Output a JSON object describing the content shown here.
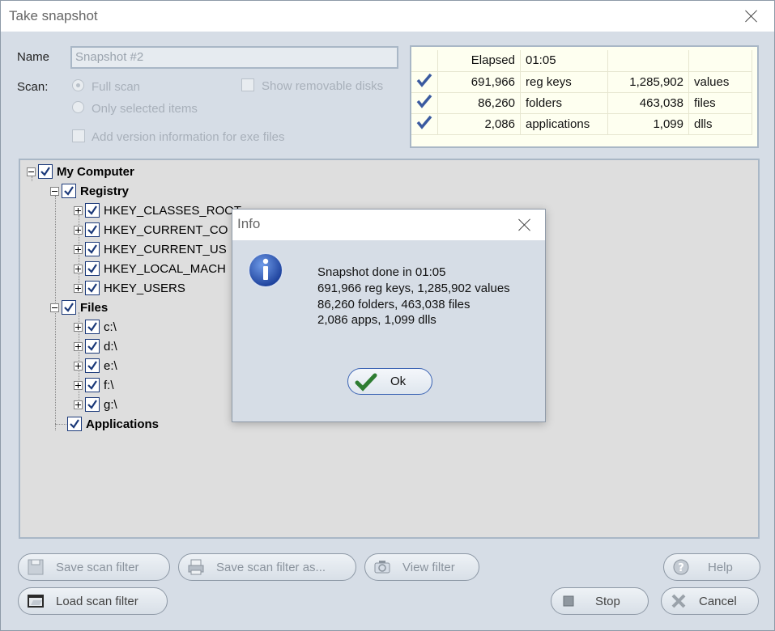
{
  "window": {
    "title": "Take snapshot"
  },
  "form": {
    "name_label": "Name",
    "name_value": "Snapshot #2",
    "scan_label": "Scan:",
    "full_scan": "Full scan",
    "only_selected": "Only selected items",
    "show_removable": "Show removable disks",
    "add_version": "Add version information for exe files"
  },
  "stats": {
    "elapsed_label": "Elapsed",
    "elapsed_value": "01:05",
    "rows": [
      {
        "count": "691,966",
        "label": "reg keys",
        "count2": "1,285,902",
        "label2": "values"
      },
      {
        "count": "86,260",
        "label": "folders",
        "count2": "463,038",
        "label2": "files"
      },
      {
        "count": "2,086",
        "label": "applications",
        "count2": "1,099",
        "label2": "dlls"
      }
    ]
  },
  "tree": {
    "root": "My Computer",
    "registry": "Registry",
    "registry_items": [
      "HKEY_CLASSES_ROOT",
      "HKEY_CURRENT_CO",
      "HKEY_CURRENT_US",
      "HKEY_LOCAL_MACH",
      "HKEY_USERS"
    ],
    "files": "Files",
    "file_items": [
      "c:\\",
      "d:\\",
      "e:\\",
      "f:\\",
      "g:\\"
    ],
    "applications": "Applications"
  },
  "buttons": {
    "save_filter": "Save scan filter",
    "save_filter_as": "Save scan filter as...",
    "view_filter": "View filter",
    "help": "Help",
    "load_filter": "Load scan filter",
    "stop": "Stop",
    "cancel": "Cancel"
  },
  "dialog": {
    "title": "Info",
    "lines": [
      "Snapshot done in 01:05",
      "691,966 reg keys, 1,285,902 values",
      "86,260 folders, 463,038 files",
      "2,086 apps, 1,099 dlls"
    ],
    "ok": "Ok"
  },
  "colors": {
    "window_bg": "#d6dde6",
    "stats_bg": "#fefff0",
    "tree_bg": "#dedede",
    "check_blue": "#1c3a7a",
    "ok_green": "#2e7d32"
  }
}
